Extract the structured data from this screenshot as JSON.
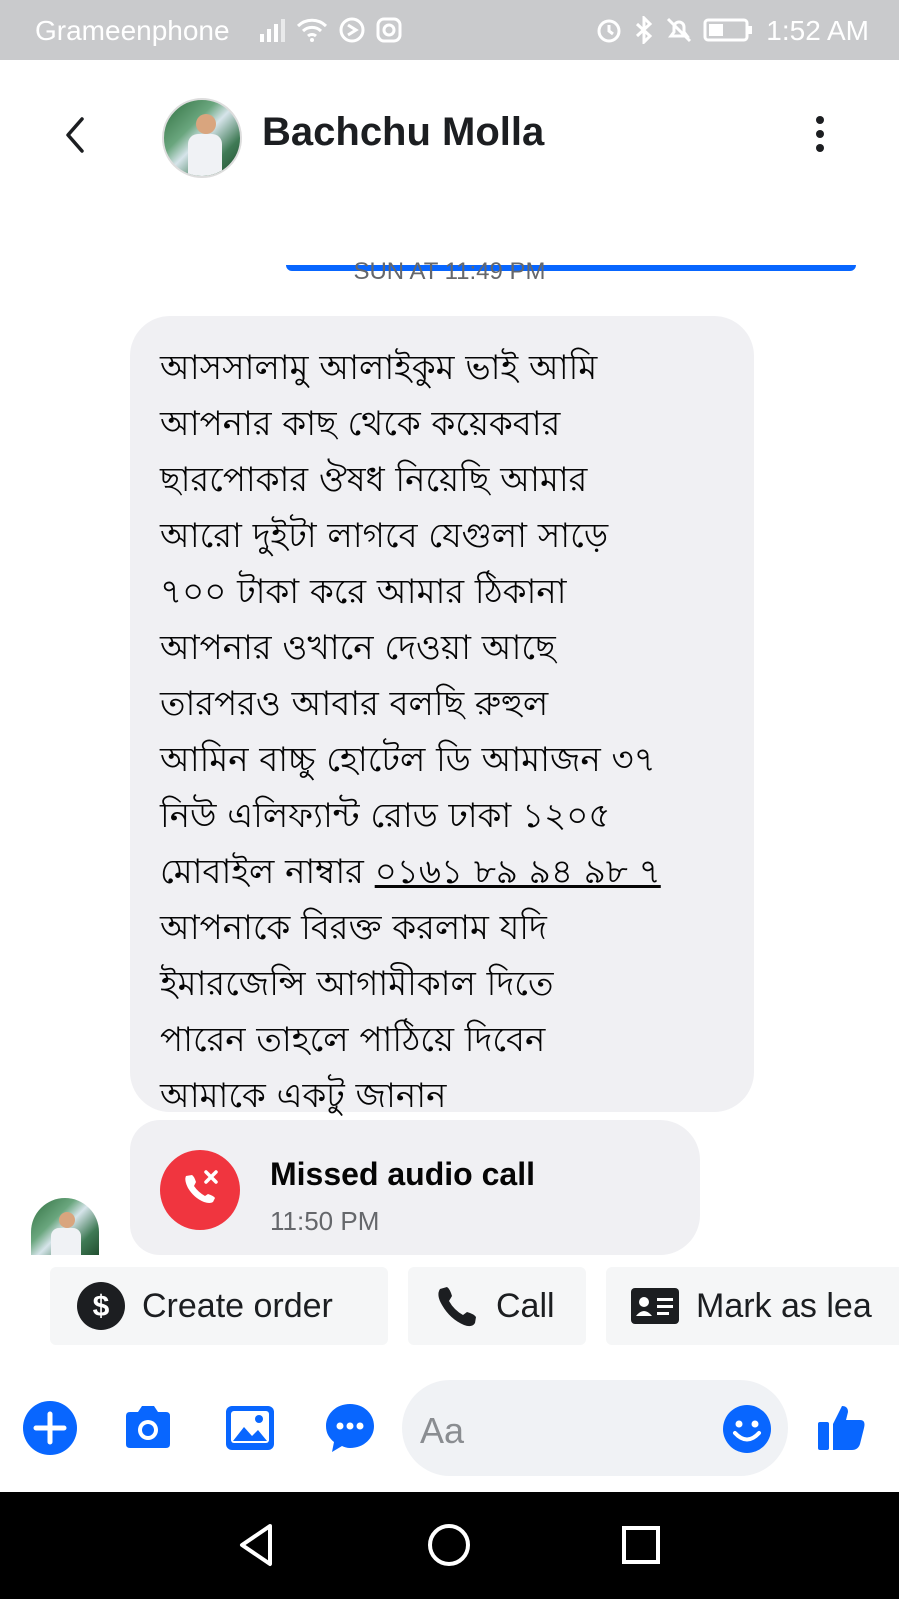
{
  "status_bar": {
    "carrier": "Grameenphone",
    "time": "1:52 AM",
    "icons": [
      "signal-icon",
      "wifi-icon",
      "sync-icon",
      "instagram-icon",
      "alarm-icon",
      "bluetooth-icon",
      "mute-icon",
      "battery-icon"
    ]
  },
  "header": {
    "contact_name": "Bachchu Molla",
    "icons": [
      "back-arrow-icon",
      "menu-dots-icon"
    ]
  },
  "chat": {
    "timestamp": "SUN AT 11:49 PM",
    "message_lines": [
      "আসসালামু আলাইকুম ভাই আমি",
      "আপনার কাছ থেকে কয়েকবার",
      "ছারপোকার ঔষধ নিয়েছি আমার",
      "আরো দুইটা লাগবে যেগুলা সাড়ে",
      "৭০০ টাকা করে আমার ঠিকানা",
      "আপনার ওখানে দেওয়া আছে",
      "তারপরও আবার বলছি রুহুল",
      "আমিন বাচ্চু হোটেল ডি আমাজন ৩৭",
      "নিউ এলিফ্যান্ট রোড ঢাকা ১২০৫"
    ],
    "phone_prefix": "মোবাইল নাম্বার ",
    "phone_number": "০১৬১ ৮৯ ৯৪ ৯৮ ৭",
    "message_lines_after": [
      "আপনাকে বিরক্ত করলাম যদি",
      "ইমারজেন্সি আগামীকাল দিতে",
      "পারেন তাহলে পাঠিয়ে দিবেন",
      "আমাকে একটু জানান"
    ],
    "call": {
      "title": "Missed audio call",
      "time": "11:50 PM",
      "icon": "missed-call-icon",
      "color": "#f0353f"
    }
  },
  "quick_actions": [
    {
      "label": "Create order",
      "icon": "dollar-icon"
    },
    {
      "label": "Call",
      "icon": "phone-icon"
    },
    {
      "label": "Mark as lea",
      "icon": "contact-card-icon"
    }
  ],
  "composer": {
    "placeholder": "Aa",
    "icons": [
      "plus-icon",
      "camera-icon",
      "gallery-icon",
      "chat-bubble-icon",
      "emoji-icon",
      "thumbs-up-icon"
    ],
    "accent": "#0866ff"
  },
  "nav_bar": {
    "icons": [
      "back-triangle-icon",
      "home-circle-icon",
      "recents-square-icon"
    ]
  }
}
